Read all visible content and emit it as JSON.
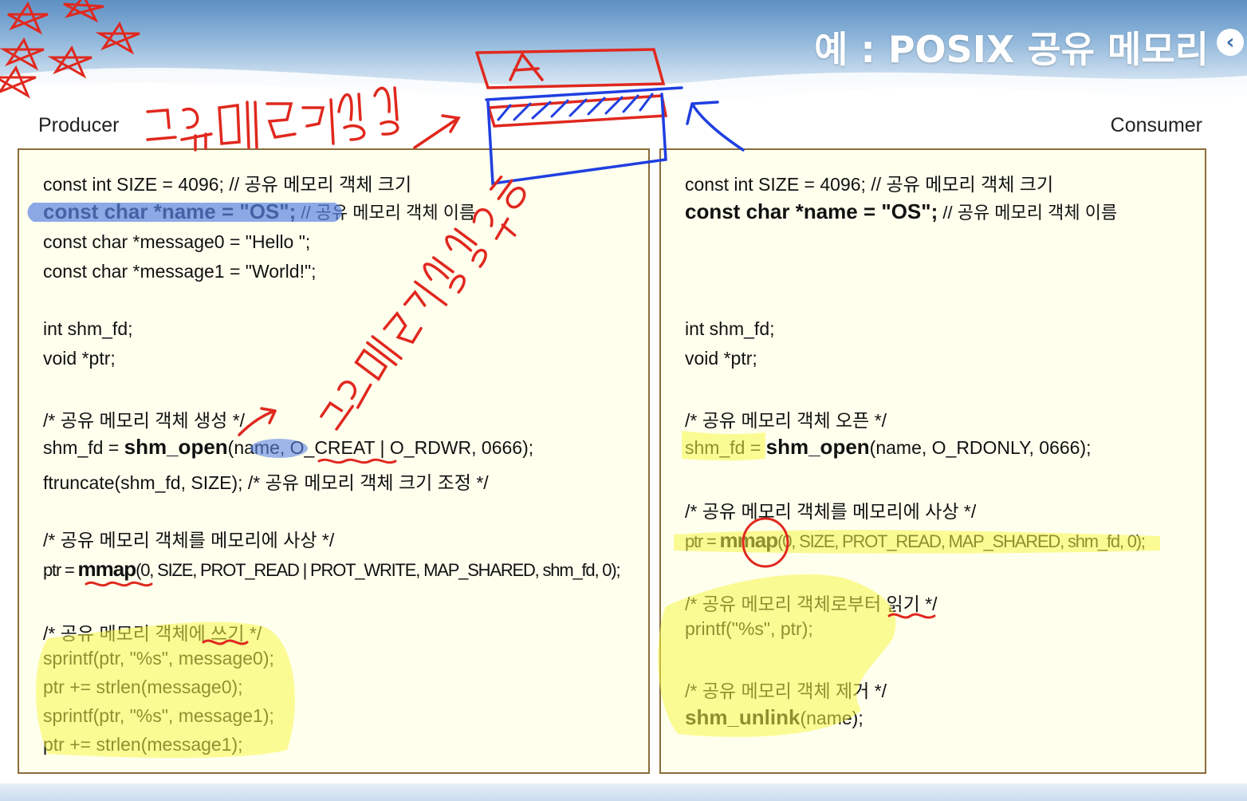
{
  "slide": {
    "title": "예 : POSIX 공유 메모리",
    "title_icon": "‹",
    "producer_label": "Producer",
    "consumer_label": "Consumer"
  },
  "producer": {
    "line1": "const int SIZE = 4096;       // 공유 메모리 객체 크기",
    "line2_code": "const char *name = \"OS\";",
    "line2_comment": " // 공유 메모리 객체 이름",
    "line3": "const char *message0 = \"Hello \";",
    "line4": "const char *message1 = \"World!\";",
    "line5": "int shm_fd;",
    "line6": "void *ptr;",
    "line7": "/* 공유 메모리 객체 생성 */",
    "line8_pre": "shm_fd = ",
    "line8_fn": "shm_open",
    "line8_post": "(name, O_CREAT | O_RDWR, 0666);",
    "line9": "ftruncate(shm_fd, SIZE); /* 공유 메모리 객체 크기 조정 */",
    "line10": "/* 공유 메모리 객체를 메모리에 사상 */",
    "line11_pre": "ptr = ",
    "line11_fn": "mmap",
    "line11_post": "(0, SIZE, PROT_READ | PROT_WRITE, MAP_SHARED, shm_fd, 0);",
    "line12": "/* 공유 메모리 객체에 쓰기 */",
    "line13": "sprintf(ptr, \"%s\", message0);",
    "line14": "ptr += strlen(message0);",
    "line15": "sprintf(ptr, \"%s\", message1);",
    "line16": "ptr += strlen(message1);"
  },
  "consumer": {
    "line1": "const int SIZE = 4096;       // 공유 메모리 객체 크기",
    "line2_code": "const char *name = \"OS\";",
    "line2_comment": " // 공유 메모리 객체 이름",
    "line3": "int shm_fd;",
    "line4": "void *ptr;",
    "line5": "/* 공유 메모리 객체 오픈 */",
    "line6_pre": "shm_fd = ",
    "line6_fn": "shm_open",
    "line6_post": "(name, O_RDONLY, 0666);",
    "line7": "/* 공유 메모리 객체를 메모리에 사상 */",
    "line8_pre": "ptr = ",
    "line8_fn": "mmap",
    "line8_post": "(0, SIZE, PROT_READ, MAP_SHARED, shm_fd, 0);",
    "line9": "/* 공유 메모리 객체로부터 읽기 */",
    "line10": "printf(\"%s\", ptr);",
    "line11": "/* 공유 메모리 객체 제거 */",
    "line12_fn": "shm_unlink",
    "line12_post": "(name);"
  },
  "handwriting": {
    "note_top": "공유메모리생성",
    "note_mid": "공유메모리생성요청",
    "box_label": "A"
  },
  "colors": {
    "ink_red": "#e0281e",
    "ink_blue": "#1f3fe0",
    "highlight_yellow": "#f7f74a",
    "highlight_blue": "#5b84e3",
    "panel_bg": "#ffffee",
    "panel_border": "#8a6d3b"
  }
}
